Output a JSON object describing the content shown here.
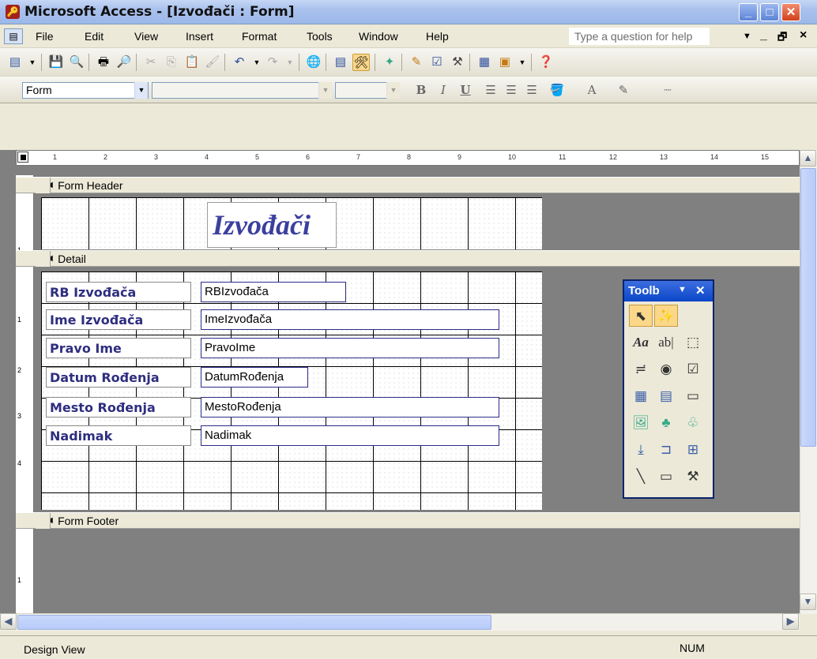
{
  "window": {
    "title": "Microsoft Access - [Izvođači : Form]",
    "app_icon": "access-key-icon",
    "controls": {
      "minimize": "_",
      "maximize": "□",
      "close": "✕"
    }
  },
  "menubar": {
    "items": [
      "File",
      "Edit",
      "View",
      "Insert",
      "Format",
      "Tools",
      "Window",
      "Help"
    ],
    "help_placeholder": "Type a question for help",
    "mdi_controls": {
      "minimize": "_",
      "restore": "🗗",
      "close": "×"
    }
  },
  "formatting_toolbar": {
    "object_combo": "Form",
    "font_combo": "",
    "size_combo": "",
    "bold": "B",
    "italic": "I",
    "underline": "U",
    "font_color": "A"
  },
  "ruler": {
    "marks": [
      "1",
      "2",
      "3",
      "4",
      "5",
      "6",
      "7",
      "8",
      "9",
      "10",
      "11",
      "12",
      "13",
      "14",
      "15"
    ],
    "vertical_marks": [
      "1",
      "1",
      "2",
      "3",
      "4",
      "1"
    ]
  },
  "sections": {
    "header": "Form Header",
    "detail": "Detail",
    "footer": "Form Footer"
  },
  "form_title": "Izvođači",
  "fields": [
    {
      "label": "RB Izvođača",
      "control": "RBIzvođača"
    },
    {
      "label": "Ime Izvođača",
      "control": "ImeIzvođača"
    },
    {
      "label": "Pravo Ime",
      "control": "PravoIme"
    },
    {
      "label": "Datum Rođenja",
      "control": "DatumRođenja"
    },
    {
      "label": "Mesto Rođenja",
      "control": "MestoRođenja"
    },
    {
      "label": "Nadimak",
      "control": "Nadimak"
    }
  ],
  "toolbox": {
    "title": "Toolb",
    "tools": [
      "pointer-icon",
      "control-wizards-icon",
      "label-icon",
      "text-box-icon",
      "option-group-icon",
      "toggle-button-icon",
      "option-button-icon",
      "check-box-icon",
      "combo-box-icon",
      "list-box-icon",
      "command-button-icon",
      "image-icon",
      "unbound-object-frame-icon",
      "bound-object-frame-icon",
      "page-break-icon",
      "tab-control-icon",
      "subform-icon",
      "line-icon",
      "rectangle-icon",
      "more-controls-icon"
    ]
  },
  "status": {
    "left": "Design View",
    "num": "NUM"
  },
  "colors": {
    "label_text": "#2e2e80",
    "title_text": "#3b3f9e",
    "titlebar": "#9cb8ea",
    "background_gray": "#808080"
  }
}
